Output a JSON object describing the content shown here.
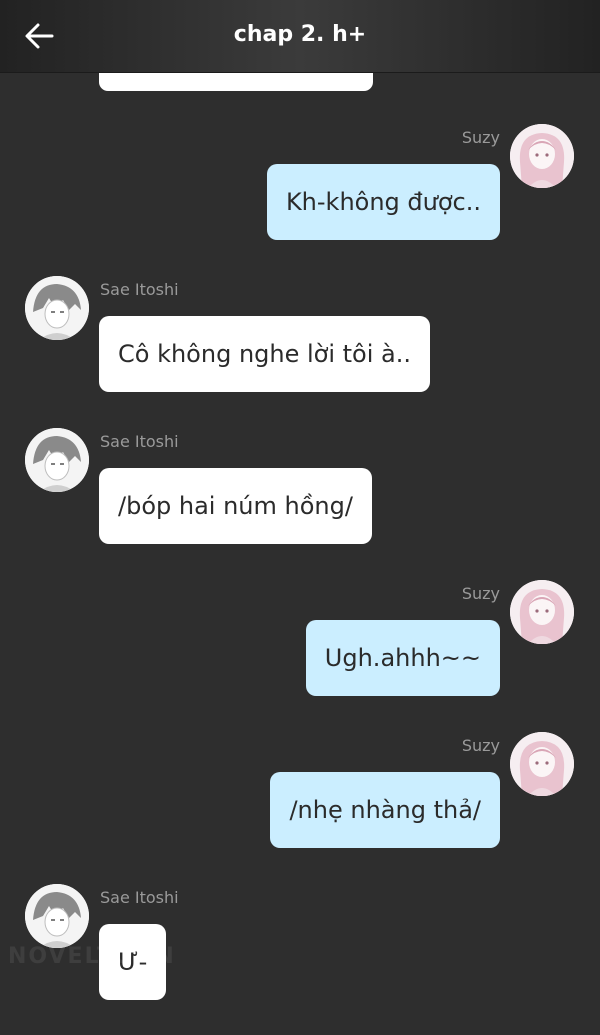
{
  "header": {
    "title": "chap 2. h+",
    "back_icon": "arrow-left-icon"
  },
  "colors": {
    "background": "#2e2e2e",
    "header": "#333333",
    "incoming_bubble": "#ffffff",
    "outgoing_bubble": "#cbeeff",
    "sender_name": "#9a9a9a"
  },
  "watermark": "NOVELTOON",
  "messages": [
    {
      "sender": "Suzy",
      "direction": "outgoing",
      "text": "Kh-không được.."
    },
    {
      "sender": "Sae Itoshi",
      "direction": "incoming",
      "text": "Cô không nghe lời tôi à.."
    },
    {
      "sender": "Sae Itoshi",
      "direction": "incoming",
      "text": "/bóp hai núm hồng/"
    },
    {
      "sender": "Suzy",
      "direction": "outgoing",
      "text": "Ugh.ahhh~~"
    },
    {
      "sender": "Suzy",
      "direction": "outgoing",
      "text": "/nhẹ nhàng thả/"
    },
    {
      "sender": "Sae Itoshi",
      "direction": "incoming",
      "text": "Ư-"
    }
  ]
}
